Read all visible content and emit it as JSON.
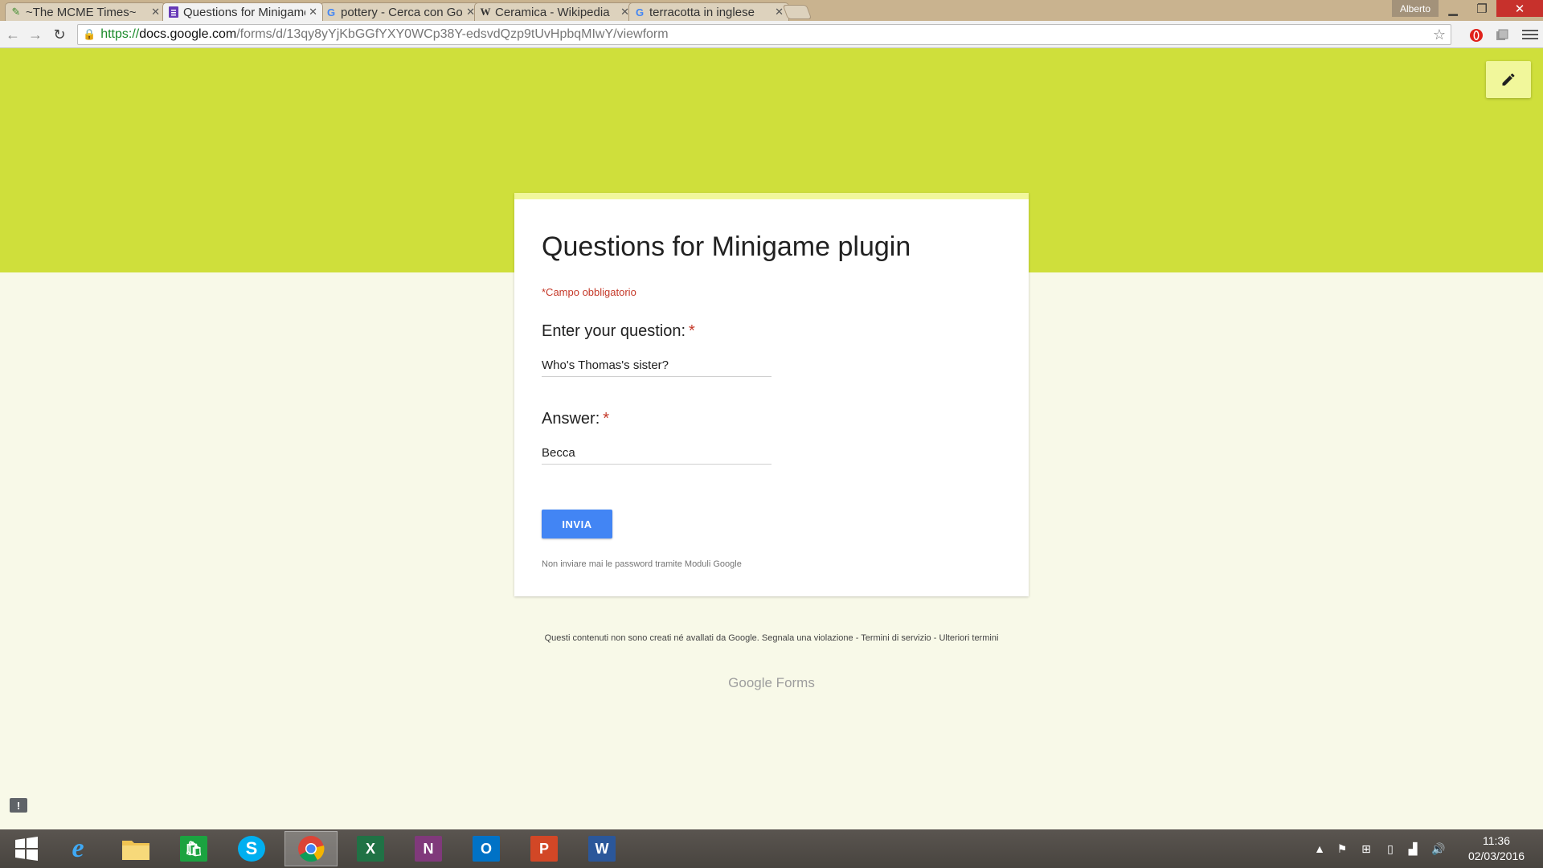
{
  "browser": {
    "tabs": [
      {
        "title": "~The MCME Times~",
        "icon": "mcme-favicon"
      },
      {
        "title": "Questions for Minigame plugin",
        "icon": "google-forms-favicon"
      },
      {
        "title": "pottery - Cerca con Google",
        "icon": "google-favicon"
      },
      {
        "title": "Ceramica - Wikipedia",
        "icon": "wikipedia-favicon"
      },
      {
        "title": "terracotta in inglese",
        "icon": "google-favicon"
      }
    ],
    "profile_name": "Alberto",
    "url": {
      "scheme": "https://",
      "host": "docs.google.com",
      "path": "/forms/d/13qy8yYjKbGGfYXY0WCp38Y-edsvdQzp9tUvHpbqMIwY/viewform"
    }
  },
  "form": {
    "title": "Questions for Minigame plugin",
    "required_note": "*Campo obbligatorio",
    "questions": [
      {
        "label": "Enter your question:",
        "required_marker": "*",
        "value": "Who's Thomas's sister?"
      },
      {
        "label": "Answer:",
        "required_marker": "*",
        "value": "Becca"
      }
    ],
    "submit_label": "INVIA",
    "password_warning": "Non inviare mai le password tramite Moduli Google"
  },
  "footer": {
    "disclaimer": "Questi contenuti non sono creati né avallati da Google.",
    "report_link": "Segnala una violazione",
    "sep1": " - ",
    "terms_link": "Termini di servizio",
    "sep2": " - ",
    "more_terms_link": "Ulteriori termini",
    "logo_text": "Google Forms"
  },
  "colors": {
    "banner": "#cfdf3b",
    "accent_light": "#f1f79b",
    "submit": "#4285f4",
    "required": "#c53929"
  },
  "taskbar": {
    "apps": [
      "windows-start-icon",
      "internet-explorer-icon",
      "file-explorer-icon",
      "store-icon",
      "skype-icon",
      "chrome-icon",
      "excel-icon",
      "onenote-icon",
      "outlook-icon",
      "powerpoint-icon",
      "word-icon"
    ],
    "time": "11:36",
    "date": "02/03/2016"
  }
}
